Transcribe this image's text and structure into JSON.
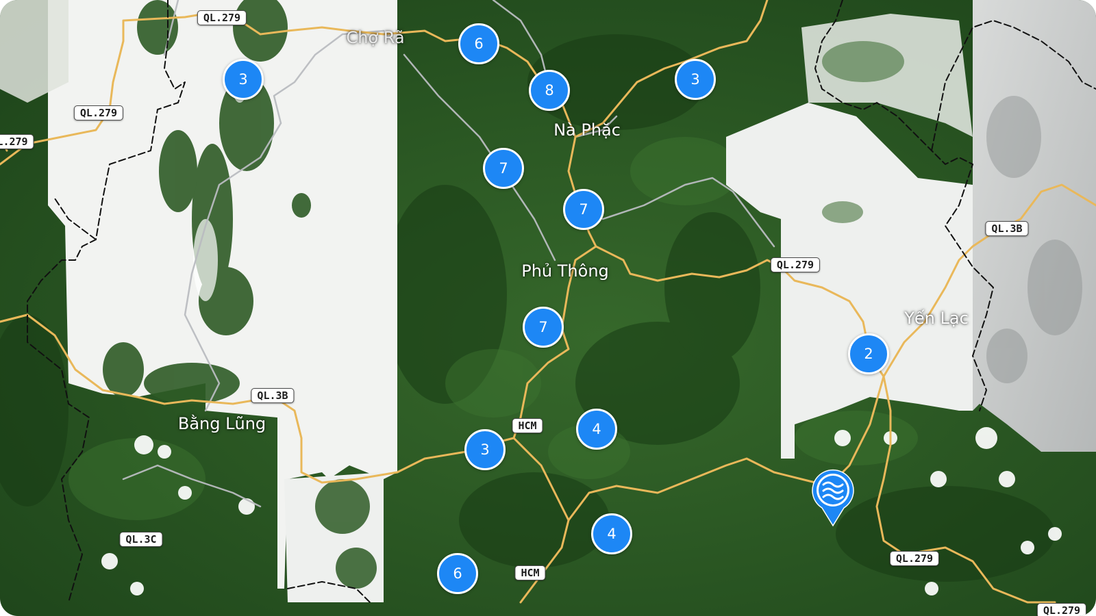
{
  "map": {
    "colors": {
      "forest_dark": "#1f4a1c",
      "forest_mid": "#2f5f27",
      "cloud": "#f4f5f3",
      "cloud_gray": "#c9cbcb",
      "road_main": "#e9b85a",
      "road_minor": "#b9bcc0",
      "boundary": "#111111",
      "cluster": "#1d87f5",
      "pin": "#1d87f5"
    },
    "places": [
      {
        "id": "cho-ra",
        "name": "Chợ Rã"
      },
      {
        "id": "na-phac",
        "name": "Nà Phặc"
      },
      {
        "id": "phu-thong",
        "name": "Phủ Thông"
      },
      {
        "id": "yen-lac",
        "name": "Yến Lạc"
      },
      {
        "id": "bang-lung",
        "name": "Bằng Lũng"
      }
    ],
    "road_shields": [
      {
        "id": "ql279-a",
        "label": "QL.279"
      },
      {
        "id": "ql279-b",
        "label": "QL.279"
      },
      {
        "id": "ql279-c",
        "label": "L.279"
      },
      {
        "id": "ql279-d",
        "label": "QL.279"
      },
      {
        "id": "ql279-e",
        "label": "QL.279"
      },
      {
        "id": "ql279-f",
        "label": "QL.279"
      },
      {
        "id": "ql3b-a",
        "label": "QL.3B"
      },
      {
        "id": "ql3b-b",
        "label": "QL.3B"
      },
      {
        "id": "ql3c",
        "label": "QL.3C"
      },
      {
        "id": "hcm-a",
        "label": "HCM"
      },
      {
        "id": "hcm-b",
        "label": "HCM"
      }
    ],
    "clusters": [
      {
        "id": "c1",
        "count": "3"
      },
      {
        "id": "c2",
        "count": "6"
      },
      {
        "id": "c3",
        "count": "8"
      },
      {
        "id": "c4",
        "count": "3"
      },
      {
        "id": "c5",
        "count": "7"
      },
      {
        "id": "c6",
        "count": "7"
      },
      {
        "id": "c7",
        "count": "7"
      },
      {
        "id": "c8",
        "count": "2"
      },
      {
        "id": "c9",
        "count": "4"
      },
      {
        "id": "c10",
        "count": "3"
      },
      {
        "id": "c11",
        "count": "4"
      },
      {
        "id": "c12",
        "count": "6"
      }
    ],
    "pin": {
      "icon": "water-waves-icon"
    }
  }
}
